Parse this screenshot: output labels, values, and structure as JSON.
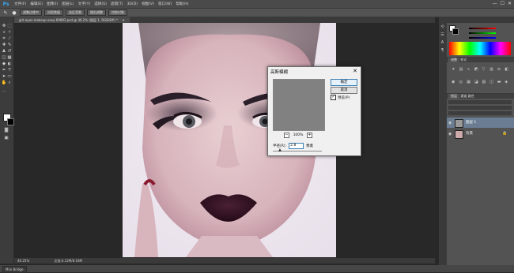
{
  "app": {
    "logo": "Ps"
  },
  "menu": [
    "文件(F)",
    "编辑(E)",
    "图像(I)",
    "图层(L)",
    "文字(Y)",
    "选择(S)",
    "滤镜(T)",
    "3D(D)",
    "视图(V)",
    "窗口(W)",
    "帮助(H)"
  ],
  "window_controls": {
    "minimize": "—",
    "maximize": "☐",
    "close": "✕"
  },
  "options": {
    "btn1": "调整边缘中",
    "btn2": "间距数量",
    "btn3": "选区背景",
    "btn4": "随机调整",
    "btn5": "控制对象"
  },
  "document": {
    "tab": "girl-eyes-makeup-sexy-69893.psd @ 46.2% (图层 1, RGB/8#) *",
    "close": "✕"
  },
  "status": {
    "zoom": "46.25%",
    "doc": "文档:4.12M/8.18M"
  },
  "bottom": {
    "bridge_tab": "Mini Bridge"
  },
  "panels": {
    "color_tab": "颜色",
    "swatches_tab": "色板",
    "adjust_tab": "调整",
    "styles_tab": "样式",
    "layers_tab": "图层",
    "channels_tab": "通道",
    "paths_tab": "路径",
    "layer1_name": "图层 1",
    "background_name": "背景"
  },
  "dialog": {
    "title": "高斯模糊",
    "close": "✕",
    "ok": "确定",
    "cancel": "取消",
    "preview_label": "预览(P)",
    "preview_checked": "✓",
    "zoom_out": "−",
    "zoom_value": "100%",
    "zoom_in": "+",
    "radius_label": "半径(R):",
    "radius_value": "2.8",
    "radius_unit": "像素",
    "radius_slider_fraction": 0.15
  },
  "colors": {
    "accent": "#37a9f5",
    "dialog_bg": "#f0f0f0",
    "workspace": "#282828"
  }
}
